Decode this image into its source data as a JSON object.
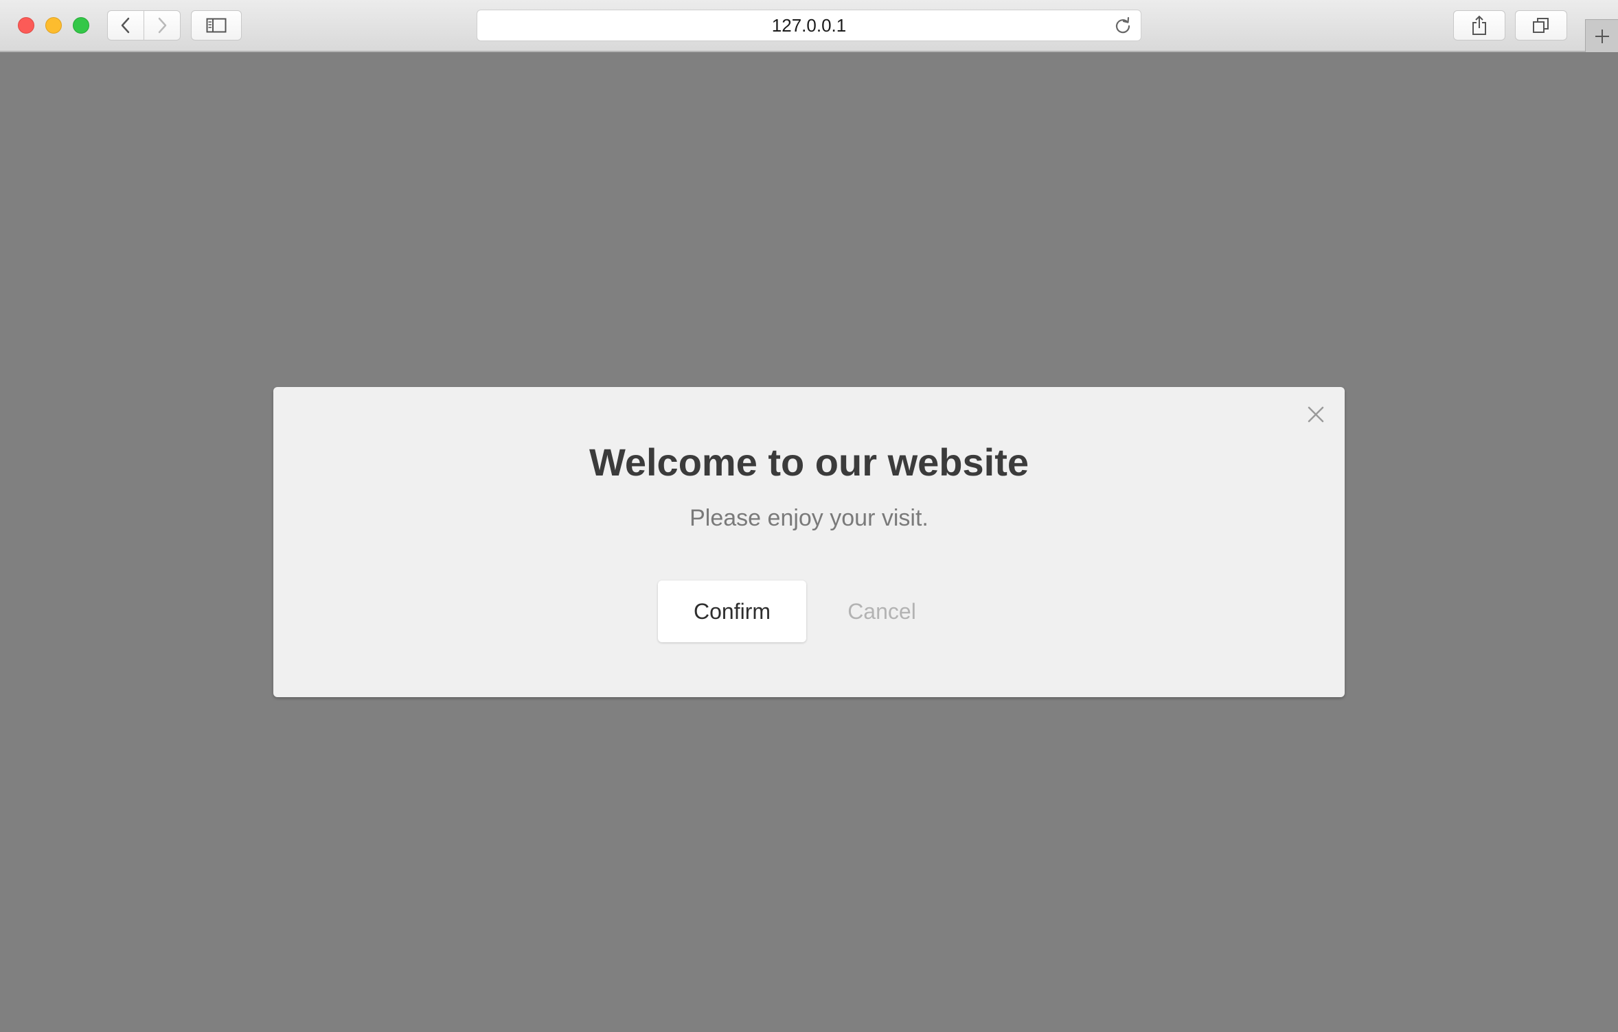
{
  "browser": {
    "address": "127.0.0.1",
    "icons": {
      "back": "chevron-left-icon",
      "forward": "chevron-right-icon",
      "sidebar": "sidebar-icon",
      "reload": "reload-icon",
      "share": "share-icon",
      "tabs": "tabs-overview-icon",
      "new_tab": "plus-icon"
    }
  },
  "modal": {
    "title": "Welcome to our website",
    "subtitle": "Please enjoy your visit.",
    "confirm_label": "Confirm",
    "cancel_label": "Cancel",
    "close_icon": "close-icon"
  },
  "colors": {
    "overlay": "#808080",
    "modal_bg": "#f0f0f0",
    "title": "#3b3b3b",
    "subtitle": "#7a7a7a",
    "cancel_text": "#b3b3b3"
  }
}
